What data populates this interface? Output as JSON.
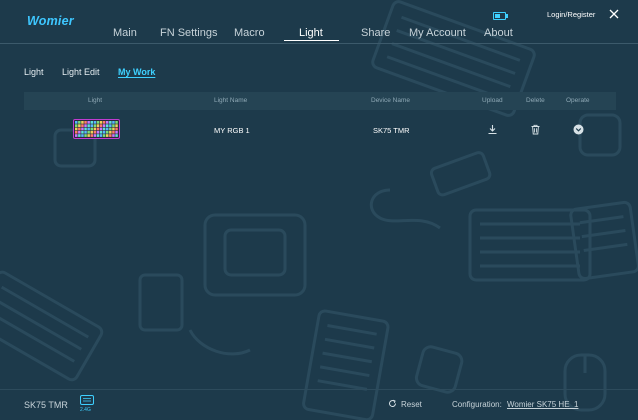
{
  "app": {
    "logo": "Womier"
  },
  "nav": [
    {
      "label": "Main"
    },
    {
      "label": "FN Settings"
    },
    {
      "label": "Macro"
    },
    {
      "label": "Light",
      "active": true
    },
    {
      "label": "Share"
    },
    {
      "label": "My Account"
    },
    {
      "label": "About"
    }
  ],
  "header": {
    "login_label": "Login/Register",
    "battery_level": 0.6
  },
  "subtabs": [
    {
      "label": "Light"
    },
    {
      "label": "Light Edit"
    },
    {
      "label": "My Work",
      "active": true
    }
  ],
  "table": {
    "columns": [
      "Light",
      "Light Name",
      "Device Name",
      "Upload",
      "Delete",
      "Operate"
    ],
    "rows": [
      {
        "light_name": "MY RGB 1",
        "device_name": "SK75 TMR"
      }
    ]
  },
  "footer": {
    "device": "SK75 TMR",
    "connection": "2.4G",
    "reset_label": "Reset",
    "config_label": "Configuration:",
    "config_value": "Womier SK75 HE_1"
  },
  "icons": [
    "battery-icon",
    "close-icon",
    "upload-icon",
    "delete-icon",
    "operate-icon",
    "reset-icon",
    "connection-icon",
    "keyboard-thumbnail"
  ],
  "colors": {
    "background": "#1d3a4b",
    "accent": "#3ed0ff",
    "logo": "#3ec7ff"
  }
}
